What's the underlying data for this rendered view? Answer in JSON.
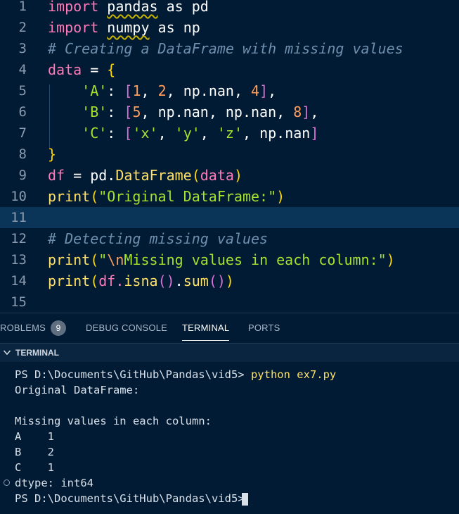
{
  "editor": {
    "lines": [
      {
        "n": "1",
        "t": [
          "import",
          " ",
          "pandas",
          " as ",
          "pd"
        ]
      },
      {
        "n": "2",
        "t": [
          "import",
          " ",
          "numpy",
          " as ",
          "np"
        ]
      },
      {
        "n": "3",
        "t": [
          "# Creating a DataFrame with missing values"
        ]
      },
      {
        "n": "4",
        "t": [
          "data",
          " = ",
          "{"
        ]
      },
      {
        "n": "5",
        "t": [
          "    ",
          "'A'",
          ": ",
          "[",
          "1",
          ", ",
          "2",
          ", np.nan, ",
          "4",
          "]",
          ","
        ]
      },
      {
        "n": "6",
        "t": [
          "    ",
          "'B'",
          ": ",
          "[",
          "5",
          ", np.nan, np.nan, ",
          "8",
          "]",
          ","
        ]
      },
      {
        "n": "7",
        "t": [
          "    ",
          "'C'",
          ": ",
          "[",
          "'x'",
          ", ",
          "'y'",
          ", ",
          "'z'",
          ", np.nan",
          "]"
        ]
      },
      {
        "n": "8",
        "t": [
          "}"
        ]
      },
      {
        "n": "9",
        "t": [
          "df",
          " = pd.",
          "DataFrame",
          "(",
          "data",
          ")"
        ]
      },
      {
        "n": "10",
        "t": [
          "print",
          "(",
          "\"Original DataFrame:\"",
          ")"
        ]
      },
      {
        "n": "11",
        "t": [
          ""
        ]
      },
      {
        "n": "12",
        "t": [
          "# Detecting missing values"
        ]
      },
      {
        "n": "13",
        "t": [
          "print",
          "(",
          "\"",
          "\\n",
          "Missing values in each column:\"",
          ")"
        ]
      },
      {
        "n": "14",
        "t": [
          "print",
          "(",
          "df.",
          "isna",
          "()",
          ".",
          "sum",
          "()",
          ")"
        ]
      },
      {
        "n": "15",
        "t": [
          ""
        ]
      }
    ]
  },
  "panel": {
    "tabs": {
      "problems": "ROBLEMS",
      "problems_count": "9",
      "debug": "DEBUG CONSOLE",
      "terminal": "TERMINAL",
      "ports": "PORTS"
    },
    "section_title": "TERMINAL",
    "terminal": {
      "prompt1": "PS D:\\Documents\\GitHub\\Pandas\\vid5> ",
      "command": "python ex7.py",
      "out1": "Original DataFrame:",
      "out2": "",
      "out3": "Missing values in each column:",
      "out4": "A    1",
      "out5": "B    2",
      "out6": "C    1",
      "out7": "dtype: int64",
      "prompt2": "PS D:\\Documents\\GitHub\\Pandas\\vid5> "
    }
  },
  "colors": {
    "background": "#001b33",
    "keyword": "#ff7ab8",
    "function": "#ffe066",
    "string": "#a6e22e",
    "number": "#ff9d5c",
    "comment": "#6f8fae"
  }
}
